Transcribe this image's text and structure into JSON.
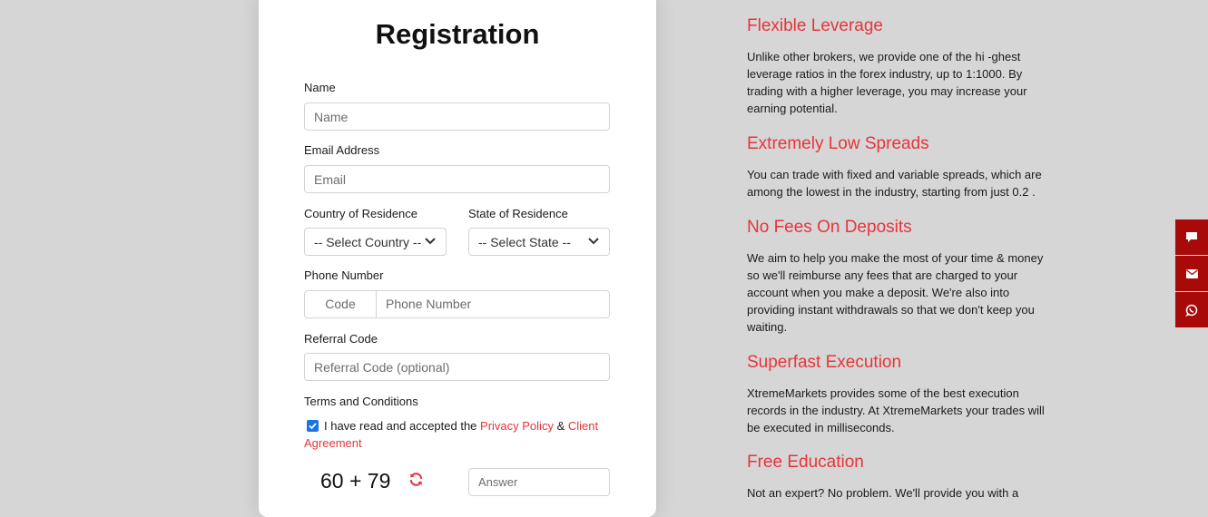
{
  "form": {
    "title": "Registration",
    "name_label": "Name",
    "name_placeholder": "Name",
    "email_label": "Email Address",
    "email_placeholder": "Email",
    "country_label": "Country of Residence",
    "country_value": "-- Select Country --",
    "state_label": "State of Residence",
    "state_value": "-- Select State --",
    "phone_label": "Phone Number",
    "phone_code_placeholder": "Code",
    "phone_number_placeholder": "Phone Number",
    "referral_label": "Referral Code",
    "referral_placeholder": "Referral Code (optional)",
    "terms_label": "Terms and Conditions",
    "agree_text": "I have read and accepted the",
    "privacy_link": "Privacy Policy",
    "ampersand": "&",
    "agreement_link": "Client Agreement",
    "captcha_question": "60 + 79",
    "answer_placeholder": "Answer"
  },
  "features": [
    {
      "heading": "Flexible Leverage",
      "text": "Unlike other brokers, we provide one of the hi -ghest leverage ratios in the forex industry, up to 1:1000. By trading with a higher leverage, you may increase your earning potential."
    },
    {
      "heading": "Extremely Low Spreads",
      "text": "You can trade with fixed and variable spreads, which are among the lowest in the industry, starting from just 0.2 ."
    },
    {
      "heading": "No Fees On Deposits",
      "text": "We aim to help you make the most of your time & money so we'll reimburse any fees that are charged to your account when you make a deposit. We're also into providing instant withdrawals so that we don't keep you waiting."
    },
    {
      "heading": "Superfast Execution",
      "text": "XtremeMarkets provides some of the best execution records in the industry. At XtremeMarkets your trades will be executed in milliseconds."
    },
    {
      "heading": "Free Education",
      "text": "Not an expert? No problem. We'll provide you with a"
    }
  ],
  "side_buttons": [
    "chat-icon",
    "email-icon",
    "whatsapp-icon"
  ],
  "colors": {
    "accent": "#e8343b",
    "side": "#a80a0a",
    "checkbox": "#1a73e8"
  }
}
